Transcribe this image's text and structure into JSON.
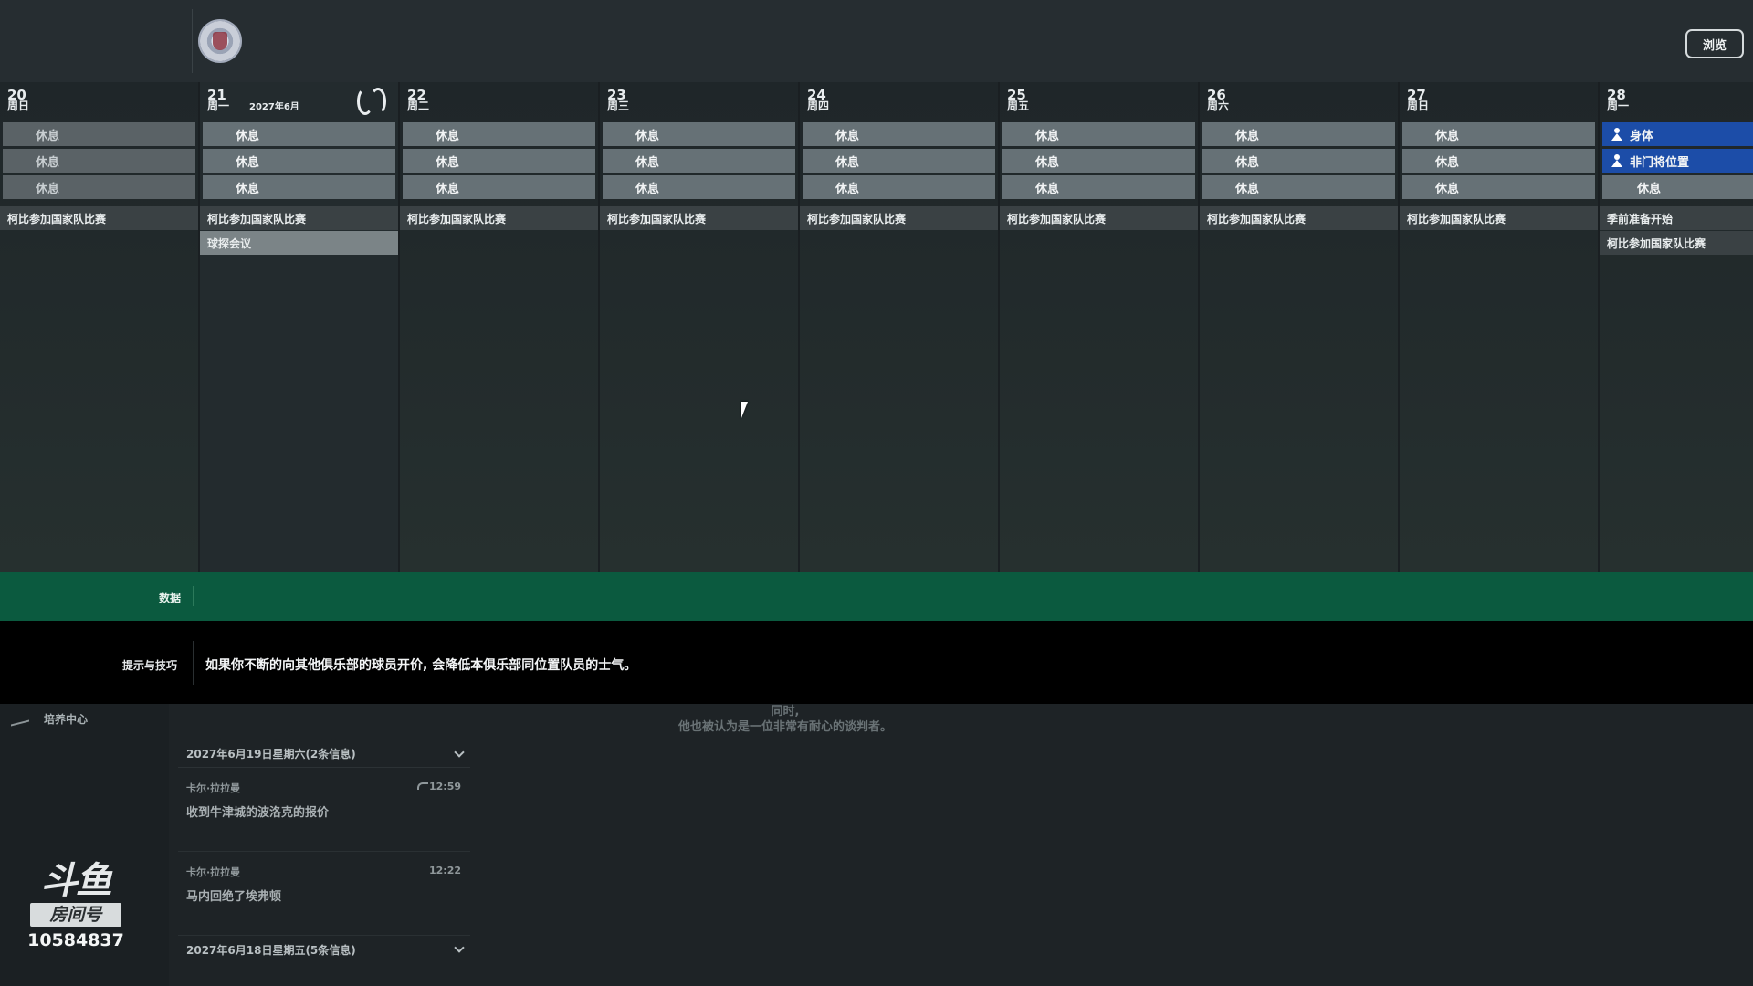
{
  "topbar": {
    "browse_label": "浏览"
  },
  "calendar": {
    "month_label": "2027年6月",
    "days": [
      {
        "num": "20",
        "name": "周日",
        "sessions": [
          "休息",
          "休息",
          "休息"
        ],
        "events": [
          "柯比参加国家队比赛"
        ]
      },
      {
        "num": "21",
        "name": "周一",
        "sessions": [
          "休息",
          "休息",
          "休息"
        ],
        "events": [
          "柯比参加国家队比赛",
          "球探会议"
        ]
      },
      {
        "num": "22",
        "name": "周二",
        "sessions": [
          "休息",
          "休息",
          "休息"
        ],
        "events": [
          "柯比参加国家队比赛"
        ]
      },
      {
        "num": "23",
        "name": "周三",
        "sessions": [
          "休息",
          "休息",
          "休息"
        ],
        "events": [
          "柯比参加国家队比赛"
        ]
      },
      {
        "num": "24",
        "name": "周四",
        "sessions": [
          "休息",
          "休息",
          "休息"
        ],
        "events": [
          "柯比参加国家队比赛"
        ]
      },
      {
        "num": "25",
        "name": "周五",
        "sessions": [
          "休息",
          "休息",
          "休息"
        ],
        "events": [
          "柯比参加国家队比赛"
        ]
      },
      {
        "num": "26",
        "name": "周六",
        "sessions": [
          "休息",
          "休息",
          "休息"
        ],
        "events": [
          "柯比参加国家队比赛"
        ]
      },
      {
        "num": "27",
        "name": "周日",
        "sessions": [
          "休息",
          "休息",
          "休息"
        ],
        "events": [
          "柯比参加国家队比赛"
        ]
      },
      {
        "num": "28",
        "name": "周一",
        "sessions": [
          "身体",
          "非门将位置",
          "休息"
        ],
        "events": [
          "季前准备开始",
          "柯比参加国家队比赛"
        ]
      }
    ]
  },
  "data_bar": {
    "label": "数据"
  },
  "tips": {
    "label": "提示与技巧",
    "text": "如果你不断的向其他俱乐部的球员开价, 会降低本俱乐部同位置队员的士气。"
  },
  "sidebar": {
    "nav_label": "培养中心"
  },
  "watermark": {
    "logo": "斗鱼",
    "room_label": "房间号",
    "room_number": "10584837"
  },
  "inbox": {
    "group1": {
      "header": "2027年6月19日星期六(2条信息)",
      "messages": [
        {
          "sender": "卡尔·拉拉曼",
          "subject": "收到牛津城的波洛克的报价",
          "time": "12:59"
        },
        {
          "sender": "卡尔·拉拉曼",
          "subject": "马内回绝了埃弗顿",
          "time": "12:22"
        }
      ]
    },
    "group2": {
      "header": "2027年6月18日星期五(5条信息)"
    }
  },
  "detail": {
    "line1": "同时,",
    "line2": "他也被认为是一位非常有耐心的谈判者。"
  }
}
